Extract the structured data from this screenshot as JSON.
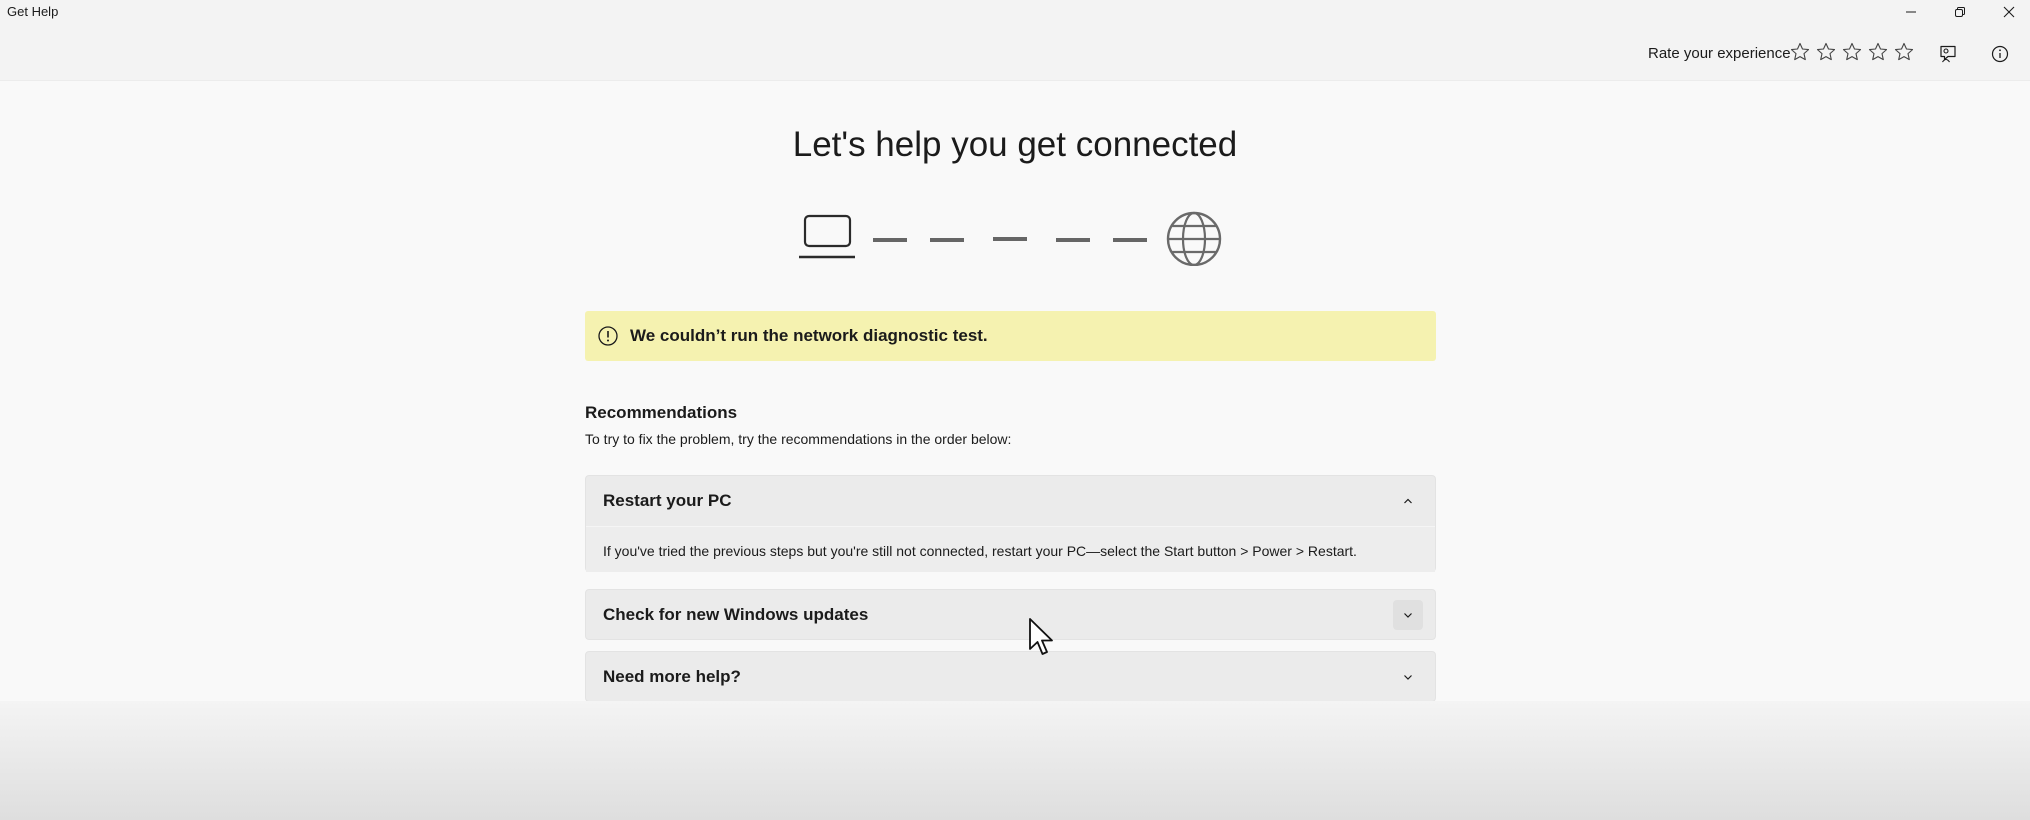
{
  "window": {
    "title": "Get Help"
  },
  "header": {
    "rate_label": "Rate your experience",
    "rating": {
      "filled": 0,
      "max": 5
    }
  },
  "main": {
    "title": "Let's help you get connected",
    "banner": {
      "text": "We couldn’t run the network diagnostic test."
    },
    "recommendations": {
      "heading": "Recommendations",
      "subtitle": "To try to fix the problem, try the recommendations in the order below:",
      "items": [
        {
          "title": "Restart your PC",
          "expanded": true,
          "body": "If you've tried the previous steps but you're still not connected, restart your PC—select the Start button > Power > Restart."
        },
        {
          "title": "Check for new Windows updates",
          "expanded": false
        },
        {
          "title": "Need more help?",
          "expanded": false
        }
      ]
    }
  },
  "colors": {
    "banner_bg": "#f5f2b0",
    "card_bg": "#ebebeb",
    "window_bg": "#f9f9f9"
  }
}
